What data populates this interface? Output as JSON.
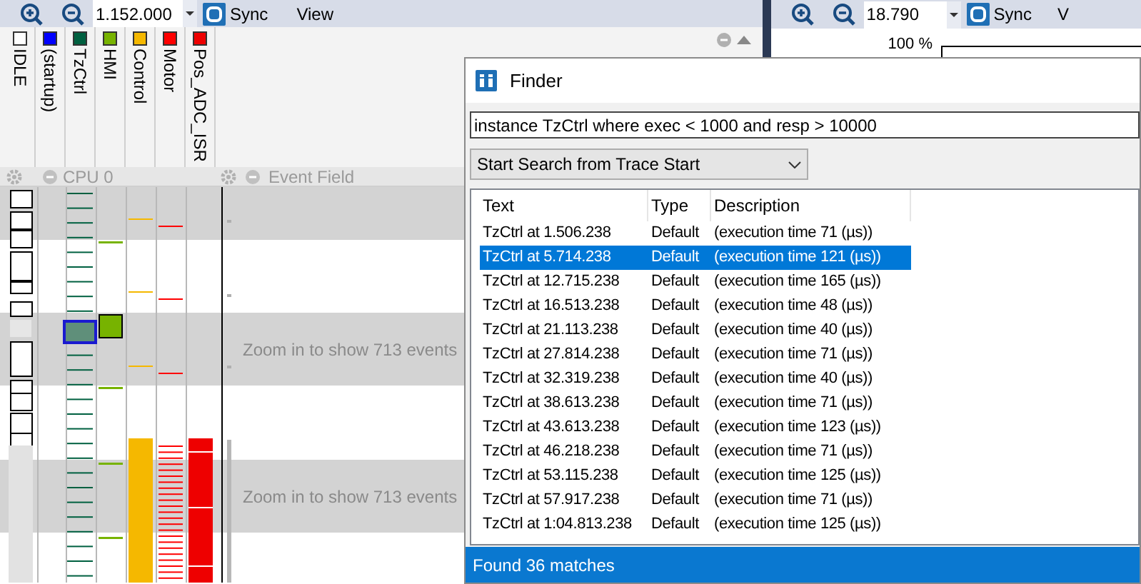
{
  "left_pane": {
    "toolbar": {
      "zoom_value": "1.152.000",
      "sync": "Sync",
      "view": "View"
    },
    "tasks": [
      {
        "label": "IDLE",
        "color": "#ffffff"
      },
      {
        "label": "(startup)",
        "color": "#0000ff"
      },
      {
        "label": "TzCtrl",
        "color": "#006040"
      },
      {
        "label": "HMI",
        "color": "#77b300"
      },
      {
        "label": "Control",
        "color": "#f5b800"
      },
      {
        "label": "Motor",
        "color": "#ff0000"
      },
      {
        "label": "Pos_ADC_ISR",
        "color": "#ee0000"
      }
    ],
    "cpu_label": "CPU 0",
    "event_field_label": "Event Field",
    "event_messages": [
      "Zoom in to show 713 events",
      "Zoom in to show 713 events"
    ]
  },
  "right_pane": {
    "toolbar": {
      "zoom_value": "18.790",
      "sync": "Sync",
      "view": "V"
    },
    "y_label": "100 %"
  },
  "finder": {
    "title": "Finder",
    "query": "instance TzCtrl where exec < 1000 and resp > 10000",
    "search_mode": "Start Search from Trace Start",
    "columns": [
      "Text",
      "Type",
      "Description"
    ],
    "rows": [
      {
        "text": "TzCtrl at 1.506.238",
        "type": "Default",
        "description": "(execution time 71 (µs))",
        "selected": false
      },
      {
        "text": "TzCtrl at 5.714.238",
        "type": "Default",
        "description": "(execution time 121 (µs))",
        "selected": true
      },
      {
        "text": "TzCtrl at 12.715.238",
        "type": "Default",
        "description": "(execution time 165 (µs))",
        "selected": false
      },
      {
        "text": "TzCtrl at 16.513.238",
        "type": "Default",
        "description": "(execution time 48 (µs))",
        "selected": false
      },
      {
        "text": "TzCtrl at 21.113.238",
        "type": "Default",
        "description": "(execution time 40 (µs))",
        "selected": false
      },
      {
        "text": "TzCtrl at 27.814.238",
        "type": "Default",
        "description": "(execution time 71 (µs))",
        "selected": false
      },
      {
        "text": "TzCtrl at 32.319.238",
        "type": "Default",
        "description": "(execution time 40 (µs))",
        "selected": false
      },
      {
        "text": "TzCtrl at 38.613.238",
        "type": "Default",
        "description": "(execution time 71 (µs))",
        "selected": false
      },
      {
        "text": "TzCtrl at 43.613.238",
        "type": "Default",
        "description": "(execution time 123 (µs))",
        "selected": false
      },
      {
        "text": "TzCtrl at 46.218.238",
        "type": "Default",
        "description": "(execution time 71 (µs))",
        "selected": false
      },
      {
        "text": "TzCtrl at 53.115.238",
        "type": "Default",
        "description": "(execution time 125 (µs))",
        "selected": false
      },
      {
        "text": "TzCtrl at 57.917.238",
        "type": "Default",
        "description": "(execution time 71 (µs))",
        "selected": false
      },
      {
        "text": "TzCtrl at 1:04.813.238",
        "type": "Default",
        "description": "(execution time 125 (µs))",
        "selected": false
      }
    ],
    "status": "Found 36 matches"
  }
}
